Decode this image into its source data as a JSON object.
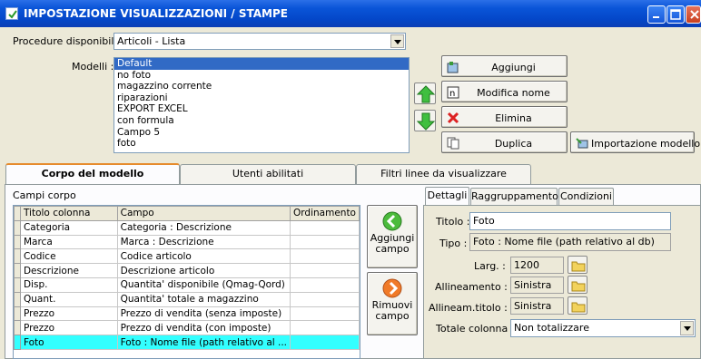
{
  "window": {
    "title": "IMPOSTAZIONE VISUALIZZAZIONI / STAMPE"
  },
  "procedure": {
    "label": "Procedure disponibili :",
    "selected": "Articoli - Lista"
  },
  "modelli": {
    "label": "Modelli :",
    "items": [
      "Default",
      "no foto",
      "magazzino corrente",
      "riparazioni",
      "EXPORT EXCEL",
      "con formula",
      "Campo 5",
      "foto"
    ],
    "selected_index": 0
  },
  "actions": {
    "aggiungi": "Aggiungi",
    "modifica_nome": "Modifica nome",
    "elimina": "Elimina",
    "duplica": "Duplica",
    "importazione": "Importazione modello"
  },
  "tabs": [
    "Corpo del modello",
    "Utenti abilitati",
    "Filtri linee da visualizzare"
  ],
  "campi": {
    "title": "Campi corpo",
    "headers": [
      "Titolo colonna",
      "Campo",
      "Ordinamento"
    ],
    "rows": [
      [
        "Categoria",
        "Categoria : Descrizione",
        ""
      ],
      [
        "Marca",
        "Marca : Descrizione",
        ""
      ],
      [
        "Codice",
        "Codice articolo",
        ""
      ],
      [
        "Descrizione",
        "Descrizione articolo",
        ""
      ],
      [
        "Disp.",
        "Quantita' disponibile (Qmag-Qord)",
        ""
      ],
      [
        "Quant.",
        "Quantita' totale a magazzino",
        ""
      ],
      [
        "Prezzo",
        "Prezzo di vendita (senza imposte)",
        ""
      ],
      [
        "Prezzo",
        "Prezzo di vendita (con imposte)",
        ""
      ],
      [
        "Foto",
        "Foto : Nome file (path relativo al ...",
        ""
      ]
    ],
    "selected_index": 8
  },
  "campo_buttons": {
    "aggiungi": [
      "Aggiungi",
      "campo"
    ],
    "rimuovi": [
      "Rimuovi",
      "campo"
    ]
  },
  "inner_tabs": [
    "Dettagli",
    "Raggruppamento",
    "Condizioni"
  ],
  "details": {
    "titolo_label": "Titolo :",
    "titolo_value": "Foto",
    "tipo_label": "Tipo :",
    "tipo_value": "Foto : Nome file (path relativo al db)",
    "larg_label": "Larg. :",
    "larg_value": "1200",
    "allineamento_label": "Allineamento :",
    "allineamento_value": "Sinistra",
    "allineam_titolo_label": "Allineam.titolo :",
    "allineam_titolo_value": "Sinistra",
    "totale_label": "Totale colonna :",
    "totale_value": "Non totalizzare"
  },
  "colors": {
    "titlebar": "#0a55d8",
    "selection": "#316ac5",
    "row_highlight": "#33ffff",
    "tab_accent": "#e68b2c"
  }
}
